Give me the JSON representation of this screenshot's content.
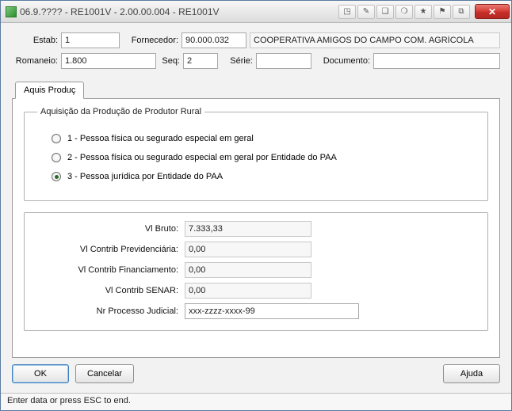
{
  "titlebar": {
    "title": "06.9.???? - RE1001V - 2.00.00.004 - RE1001V",
    "close": "✕"
  },
  "header": {
    "estab_label": "Estab:",
    "estab_value": "1",
    "fornecedor_label": "Fornecedor:",
    "fornecedor_value": "90.000.032",
    "fornecedor_nome": "COOPERATIVA AMIGOS DO CAMPO COM. AGRÍCOLA",
    "romaneio_label": "Romaneio:",
    "romaneio_value": "1.800",
    "seq_label": "Seq:",
    "seq_value": "2",
    "serie_label": "Série:",
    "serie_value": "",
    "documento_label": "Documento:",
    "documento_value": ""
  },
  "tabs": {
    "aquis": "Aquis Produç"
  },
  "group": {
    "legend": "Aquisição da Produção de Produtor Rural",
    "opt1": "1 - Pessoa física ou segurado especial em geral",
    "opt2": "2 - Pessoa física ou segurado especial em geral por Entidade do PAA",
    "opt3": "3 - Pessoa jurídica por Entidade do PAA",
    "selected": 3
  },
  "values": {
    "vl_bruto_label": "Vl Bruto:",
    "vl_bruto": "7.333,33",
    "vl_prev_label": "Vl Contrib Previdenciária:",
    "vl_prev": "0,00",
    "vl_fin_label": "Vl Contrib Financiamento:",
    "vl_fin": "0,00",
    "vl_senar_label": "Vl Contrib SENAR:",
    "vl_senar": "0,00",
    "nr_proc_label": "Nr Processo Judicial:",
    "nr_proc": "xxx-zzzz-xxxx-99"
  },
  "buttons": {
    "ok": "OK",
    "cancelar": "Cancelar",
    "ajuda": "Ajuda"
  },
  "status": "Enter data or press ESC to end."
}
